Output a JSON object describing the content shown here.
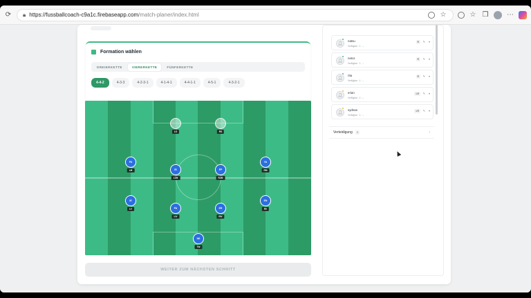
{
  "browser": {
    "url_host": "https://fussballcoach-c9a1c.firebaseapp.com",
    "url_path": "/match-planer/index.html"
  },
  "formation": {
    "title": "Formation wählen",
    "tabs": [
      {
        "label": "DREIERKETTE",
        "active": false
      },
      {
        "label": "VIERERKETTE",
        "active": true
      },
      {
        "label": "FÜNFERKETTE",
        "active": false
      }
    ],
    "options": [
      {
        "label": "4-4-2",
        "active": true
      },
      {
        "label": "4-3-3",
        "active": false
      },
      {
        "label": "4-2-3-1",
        "active": false
      },
      {
        "label": "4-1-4-1",
        "active": false
      },
      {
        "label": "4-4-1-1",
        "active": false
      },
      {
        "label": "4-5-1",
        "active": false
      },
      {
        "label": "4-3-2-1",
        "active": false
      }
    ]
  },
  "pitch": {
    "players": [
      {
        "initials": "",
        "pos": "LS",
        "empty": true
      },
      {
        "initials": "",
        "pos": "RS",
        "empty": true
      },
      {
        "initials": "PA",
        "pos": "LM",
        "empty": false
      },
      {
        "initials": "IB",
        "pos": "LZM",
        "empty": false
      },
      {
        "initials": "EP",
        "pos": "RZM",
        "empty": false
      },
      {
        "initials": "YA",
        "pos": "RM",
        "empty": false
      },
      {
        "initials": "IE",
        "pos": "LV",
        "empty": false
      },
      {
        "initials": "PA",
        "pos": "LIV",
        "empty": false
      },
      {
        "initials": "ER",
        "pos": "RIV",
        "empty": false
      },
      {
        "initials": "EN",
        "pos": "RV",
        "empty": false
      },
      {
        "initials": "HE",
        "pos": "TW",
        "empty": false
      }
    ]
  },
  "next_button": "WEITER ZUM NÄCHSTEN SCHRITT",
  "sidebar": {
    "players": [
      {
        "name": "natsu",
        "meta": "Verfügbar · 1 · –",
        "pos": "R",
        "status": "green"
      },
      {
        "name": "netcs",
        "meta": "Verfügbar · 1 · –",
        "pos": "R",
        "status": "green"
      },
      {
        "name": "rita",
        "meta": "Verfügbar · 1 · –",
        "pos": "R",
        "status": "green"
      },
      {
        "name": "erian",
        "meta": "Verfügbar · 1 · –",
        "pos": "LR",
        "status": "yellow"
      },
      {
        "name": "sydnas",
        "meta": "Verfügbar · 1 · –",
        "pos": "LR",
        "status": "yellow"
      }
    ],
    "section_label": "Verteidigung",
    "section_count": "0"
  }
}
